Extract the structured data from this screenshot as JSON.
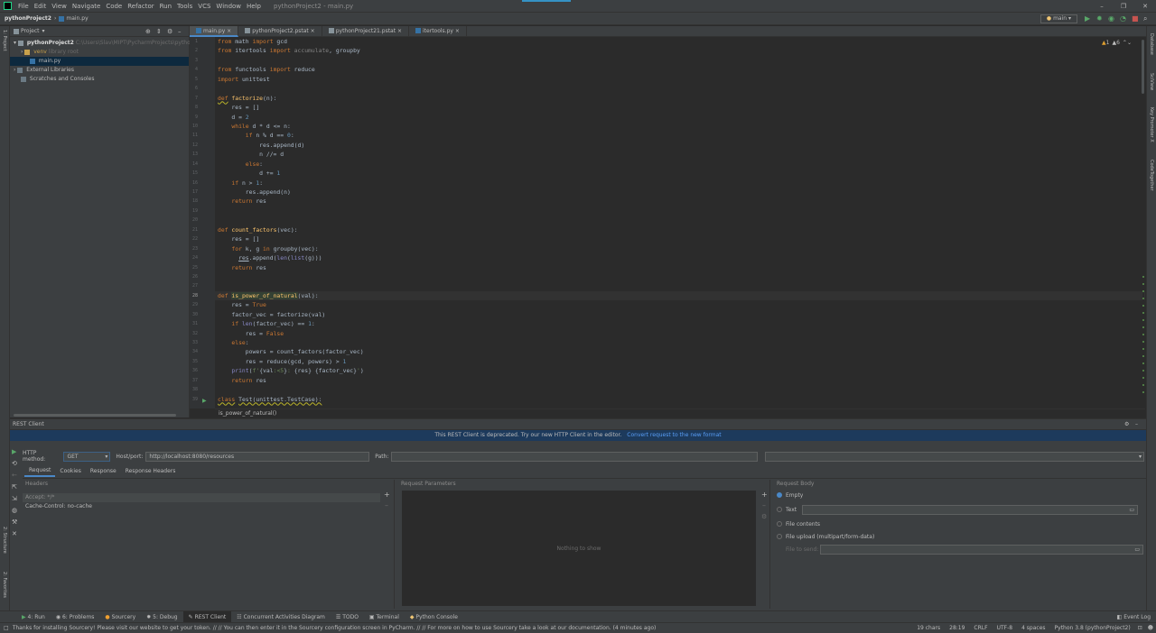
{
  "menu": {
    "items": [
      "File",
      "Edit",
      "View",
      "Navigate",
      "Code",
      "Refactor",
      "Run",
      "Tools",
      "VCS",
      "Window",
      "Help"
    ],
    "window_title": "pythonProject2 - main.py"
  },
  "nav": {
    "project": "pythonProject2",
    "file": "main.py",
    "run_config": "main"
  },
  "left_strip": {
    "project_label": "1: Project",
    "structure_label": "2: Structure",
    "favorites_label": "2: Favorites"
  },
  "right_strip": {
    "database": "Database",
    "sciview": "SciView",
    "key_promoter": "Key Promoter X",
    "codeglance": "CodeTogether"
  },
  "project_panel": {
    "title": "Project",
    "tree": [
      {
        "label": "pythonProject2",
        "path": "C:\\Users\\Slav\\MIPT\\PycharmProjects\\pythonPro"
      },
      {
        "label": "venv",
        "note": "library root"
      },
      {
        "label": "main.py"
      },
      {
        "label": "External Libraries"
      },
      {
        "label": "Scratches and Consoles"
      }
    ]
  },
  "editor": {
    "tabs": [
      "main.py",
      "pythonProject2.pstat",
      "pythonProject21.pstat",
      "itertools.py"
    ],
    "inspection": {
      "warnings": "1",
      "weak": "6"
    },
    "breadcrumb": "is_power_of_natural()"
  },
  "rest": {
    "title": "REST Client",
    "banner": "This REST Client is deprecated. Try our new HTTP Client in the editor.",
    "banner_link": "Convert request to the new format",
    "http_method_label": "HTTP method:",
    "http_method": "GET",
    "host_label": "Host/port:",
    "host": "http://localhost:8080/resources",
    "path_label": "Path:",
    "tabs": [
      "Request",
      "Cookies",
      "Response",
      "Response Headers"
    ],
    "headers_title": "Headers",
    "headers": [
      "Accept: */*",
      "Cache-Control: no-cache"
    ],
    "params_title": "Request Parameters",
    "params_empty": "Nothing to show",
    "body_title": "Request Body",
    "body_options": [
      "Empty",
      "Text",
      "File contents",
      "File upload (multipart/form-data)"
    ],
    "file_to_send": "File to send:"
  },
  "bottom_tabs": [
    "4: Run",
    "6: Problems",
    "Sourcery",
    "5: Debug",
    "REST Client",
    "Concurrent Activities Diagram",
    "TODO",
    "Terminal",
    "Python Console"
  ],
  "event_log": "Event Log",
  "status": {
    "message": "Thanks for installing Sourcery! Please visit our website to get your token. // // You can then enter it in the Sourcery configuration screen in PyCharm. // // For more on how to use Sourcery take a look at our documentation. (4 minutes ago)",
    "chars": "19 chars",
    "pos": "28:19",
    "eol": "CRLF",
    "enc": "UTF-8",
    "indent": "4 spaces",
    "interp": "Python 3.8 (pythonProject2)"
  }
}
